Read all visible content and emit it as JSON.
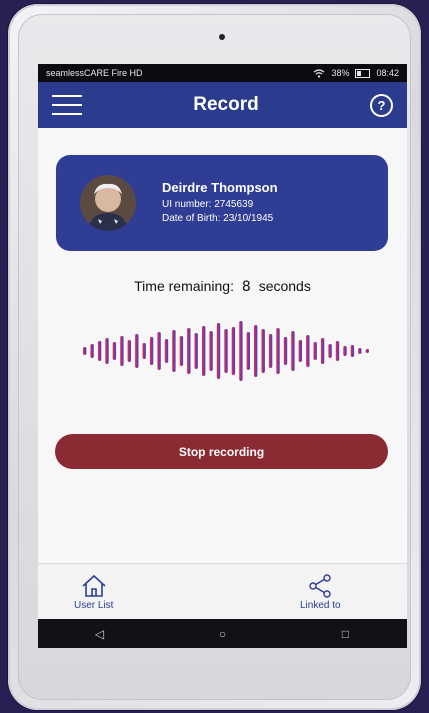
{
  "status_bar": {
    "device_name": "seamlessCARE Fire HD",
    "battery_percent": "38%",
    "time": "08:42"
  },
  "app_bar": {
    "title": "Record"
  },
  "patient": {
    "name": "Deirdre Thompson",
    "ui_number": "UI number: 2745639",
    "dob": "Date of Birth: 23/10/1945"
  },
  "recording": {
    "time_label": "Time remaining:",
    "time_value": "8",
    "time_unit": "seconds",
    "stop_label": "Stop recording"
  },
  "bottom_nav": {
    "user_list_label": "User List",
    "linked_label": "Linked to"
  },
  "icons": {
    "menu": "menu-icon",
    "help": "help-icon",
    "home": "home-icon",
    "share": "share-icon",
    "wifi": "wifi-icon",
    "battery": "battery-icon",
    "back": "back-icon",
    "home_sys": "home-circle-icon",
    "recent": "recent-apps-icon"
  },
  "colors": {
    "primary": "#2b3b8e",
    "stop_button": "#8a2a32",
    "wave_start": "#e03a3a",
    "wave_mid": "#9b2aa0",
    "wave_end": "#3b4fa0"
  }
}
